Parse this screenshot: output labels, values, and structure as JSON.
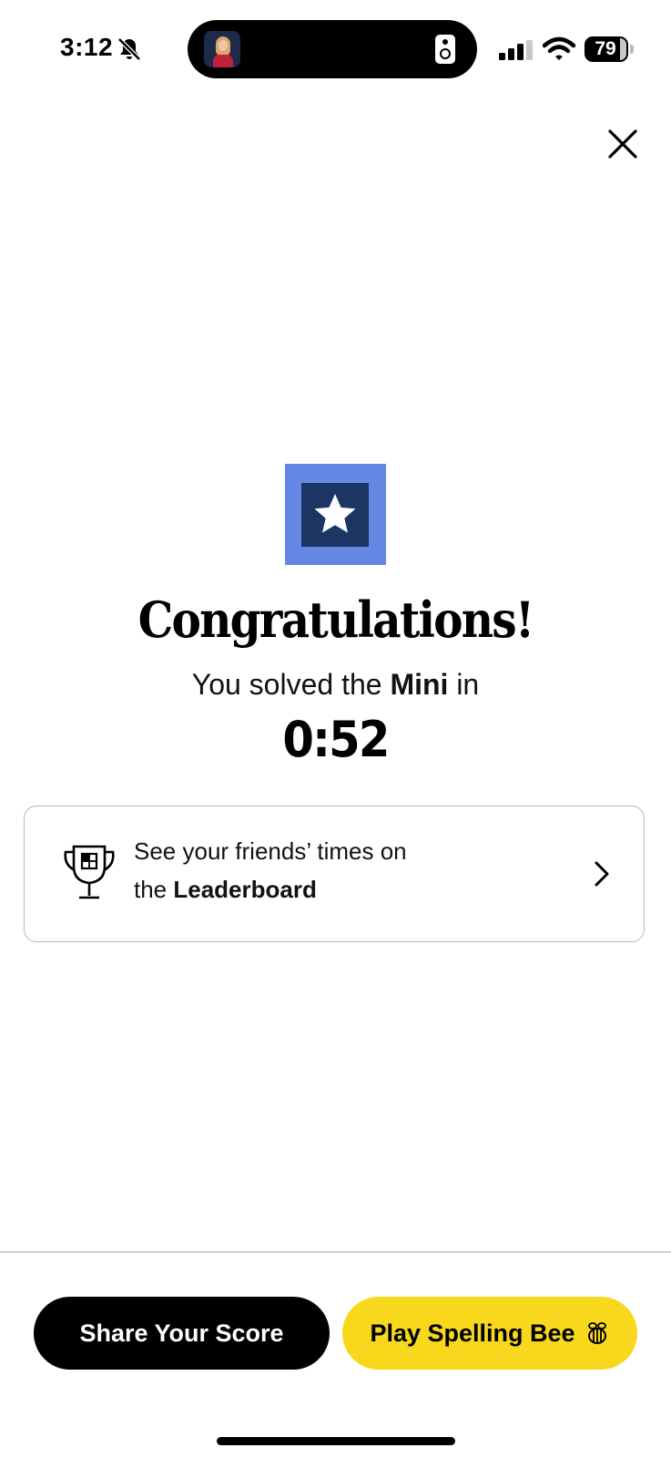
{
  "status_bar": {
    "time": "3:12",
    "battery": "79",
    "icons": [
      "bell-muted-icon",
      "speaker-icon",
      "cellular-signal-icon",
      "wifi-icon",
      "battery-icon"
    ]
  },
  "header": {
    "close_icon": "close-icon"
  },
  "result": {
    "badge_icon": "star-icon",
    "headline": "Congratulations!",
    "sub_prefix": "You solved the ",
    "sub_game": "Mini",
    "sub_suffix": " in",
    "time": "0:52"
  },
  "leaderboard": {
    "icon": "trophy-icon",
    "line1": "See your friends’ times on",
    "line2_prefix": "the ",
    "line2_bold": "Leaderboard",
    "chevron_icon": "chevron-right-icon"
  },
  "actions": {
    "share_label": "Share Your Score",
    "bee_label": "Play Spelling Bee",
    "bee_icon": "bee-icon"
  },
  "colors": {
    "badge_outer": "#6488e3",
    "badge_inner": "#1d3563",
    "bee_button": "#f7d81c",
    "share_button": "#000000"
  }
}
